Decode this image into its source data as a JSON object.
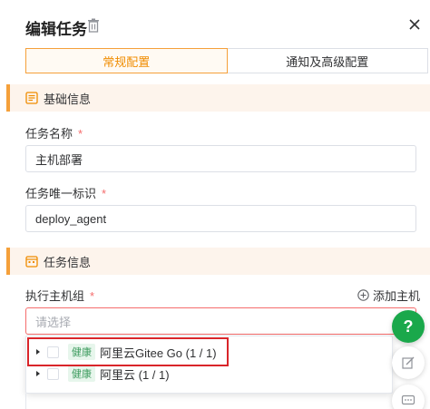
{
  "header": {
    "title": "编辑任务"
  },
  "tabs": [
    {
      "label": "常规配置",
      "active": true
    },
    {
      "label": "通知及高级配置",
      "active": false
    }
  ],
  "sections": {
    "basic": "基础信息",
    "task": "任务信息"
  },
  "fields": {
    "task_name": {
      "label": "任务名称",
      "required": "*",
      "value": "主机部署"
    },
    "task_id": {
      "label": "任务唯一标识",
      "required": "*",
      "value": "deploy_agent"
    },
    "host_group": {
      "label": "执行主机组",
      "required": "*",
      "placeholder": "请选择",
      "add_label": "添加主机"
    }
  },
  "dropdown": {
    "options": [
      {
        "badge": "健康",
        "label": "阿里云Gitee Go (1 / 1)"
      },
      {
        "badge": "健康",
        "label": "阿里云 (1 / 1)"
      }
    ]
  },
  "floating": {
    "help": "?"
  },
  "colors": {
    "accent": "#f5a03a",
    "success": "#1aa84b",
    "error": "#f56c6c",
    "highlight": "#d9252a"
  }
}
